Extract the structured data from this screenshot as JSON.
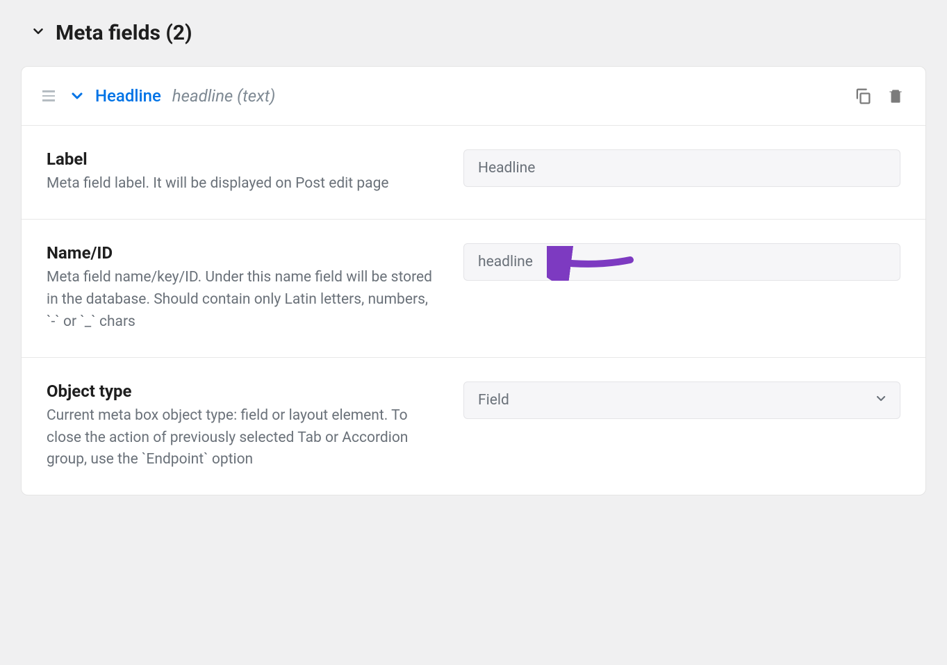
{
  "section": {
    "title": "Meta fields (2)"
  },
  "field": {
    "title": "Headline",
    "subtitle": "headline (text)"
  },
  "rows": {
    "label": {
      "title": "Label",
      "desc": "Meta field label. It will be displayed on Post edit page",
      "value": "Headline"
    },
    "name_id": {
      "title": "Name/ID",
      "desc": "Meta field name/key/ID. Under this name field will be stored in the database. Should contain only Latin letters, numbers, `-` or `_` chars",
      "value": "headline"
    },
    "object_type": {
      "title": "Object type",
      "desc": "Current meta box object type: field or layout element. To close the action of previously selected Tab or Accordion group, use the `Endpoint` option",
      "value": "Field"
    }
  },
  "annotation": {
    "color": "#7d3ac1"
  }
}
